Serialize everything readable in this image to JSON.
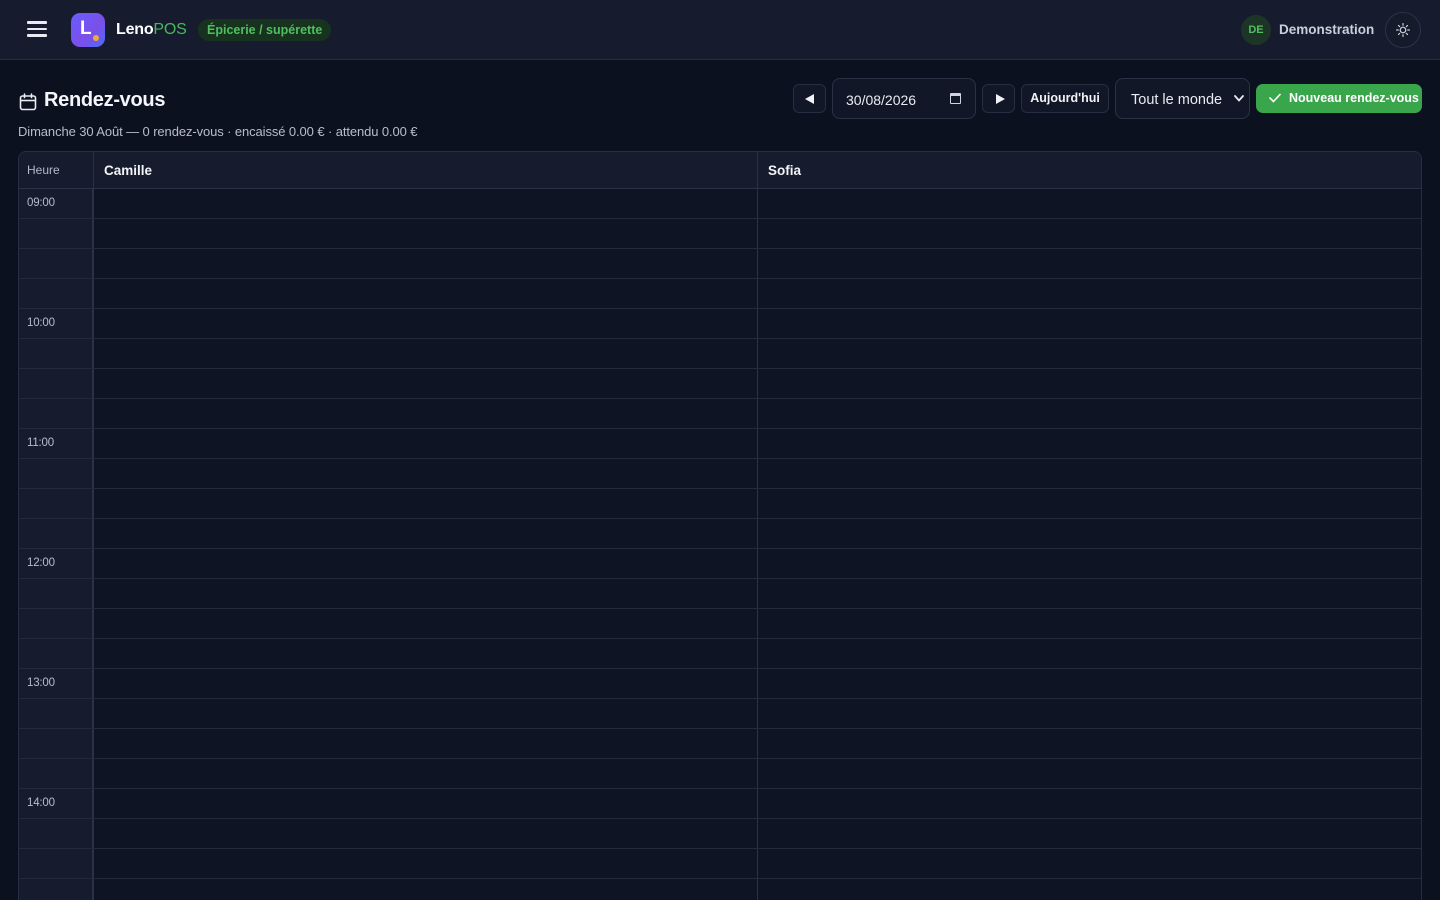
{
  "app": {
    "brand_first": "Leno",
    "brand_second": "POS",
    "logo_letter": "L",
    "store_type": "Épicerie / supérette",
    "user_initials": "DE",
    "user_name": "Demonstration",
    "accent_color": "#3aa64c",
    "logo_color": "#6a5cff"
  },
  "icons": {
    "menu": "hamburger-icon",
    "theme": "sun-icon",
    "title": "calendar-icon",
    "prev": "triangle-left-icon",
    "next": "triangle-right-icon",
    "new": "check-icon"
  },
  "page": {
    "title": "Rendez-vous",
    "subtitle": "Dimanche 30 Août — 0 rendez-vous · encaissé 0.00 € · attendu 0.00 €"
  },
  "toolbar": {
    "date_value": "30/08/2026",
    "today_label": "Aujourd'hui",
    "staff_filter": "Tout le monde",
    "new_label": "Nouveau rendez-vous"
  },
  "calendar": {
    "hour_header": "Heure",
    "staff": [
      "Camille",
      "Sofia"
    ],
    "slots": [
      "09:00",
      "",
      "",
      "",
      "10:00",
      "",
      "",
      "",
      "11:00",
      "",
      "",
      "",
      "12:00",
      "",
      "",
      "",
      "13:00",
      "",
      "",
      "",
      "14:00",
      "",
      "",
      ""
    ]
  }
}
